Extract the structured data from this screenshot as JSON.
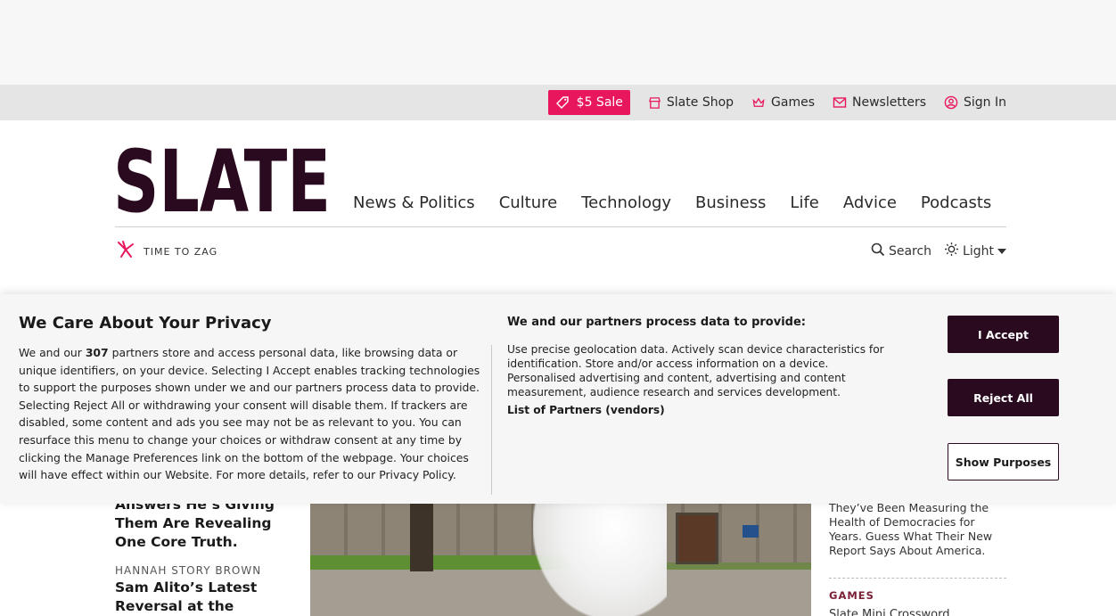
{
  "topbar": {
    "sale": "$5 Sale",
    "shop": "Slate Shop",
    "games": "Games",
    "newsletters": "Newsletters",
    "signin": "Sign In"
  },
  "brand": {
    "logo": "SLATE"
  },
  "nav": [
    "News & Politics",
    "Culture",
    "Technology",
    "Business",
    "Life",
    "Advice",
    "Podcasts"
  ],
  "subheader": {
    "tagline": "TIME TO ZAG",
    "search": "Search",
    "theme": "Light"
  },
  "content": {
    "left_headline_1": "Answers He’s Giving Them Are Revealing One Core Truth.",
    "byline": "HANNAH STORY BROWN",
    "left_headline_2": "Sam Alito’s Latest Reversal at the Supreme",
    "right_text": "They’ve Been Measuring the Health of Democracies for Years. Guess What Their New Report Says About America.",
    "section_label": "GAMES",
    "game_link": "Slate Mini Crossword"
  },
  "privacy": {
    "title": "We Care About Your Privacy",
    "body_pre": "We and our ",
    "partner_count": "307",
    "body_post": " partners store and access personal data, like browsing data or unique identifiers, on your device. Selecting I Accept enables tracking technologies to support the purposes shown under we and our partners process data to provide. Selecting Reject All or withdrawing your consent will disable them. If trackers are disabled, some content and ads you see may not be as relevant to you. You can resurface this menu to change your choices or withdraw consent at any time by clicking the Manage Preferences link on the bottom of the webpage. Your choices will have effect within our Website. For more details, refer to our Privacy Policy.",
    "subtitle": "We and our partners process data to provide:",
    "purposes": "Use precise geolocation data. Actively scan device characteristics for identification. Store and/or access information on a device. Personalised advertising and content, advertising and content measurement, audience research and services development.",
    "partners_link": "List of Partners (vendors)",
    "accept": "I Accept",
    "reject": "Reject All",
    "purposes_btn": "Show Purposes"
  },
  "colors": {
    "brand": "#2a0a1f",
    "sale": "#e8175d",
    "section": "#7a2137"
  }
}
